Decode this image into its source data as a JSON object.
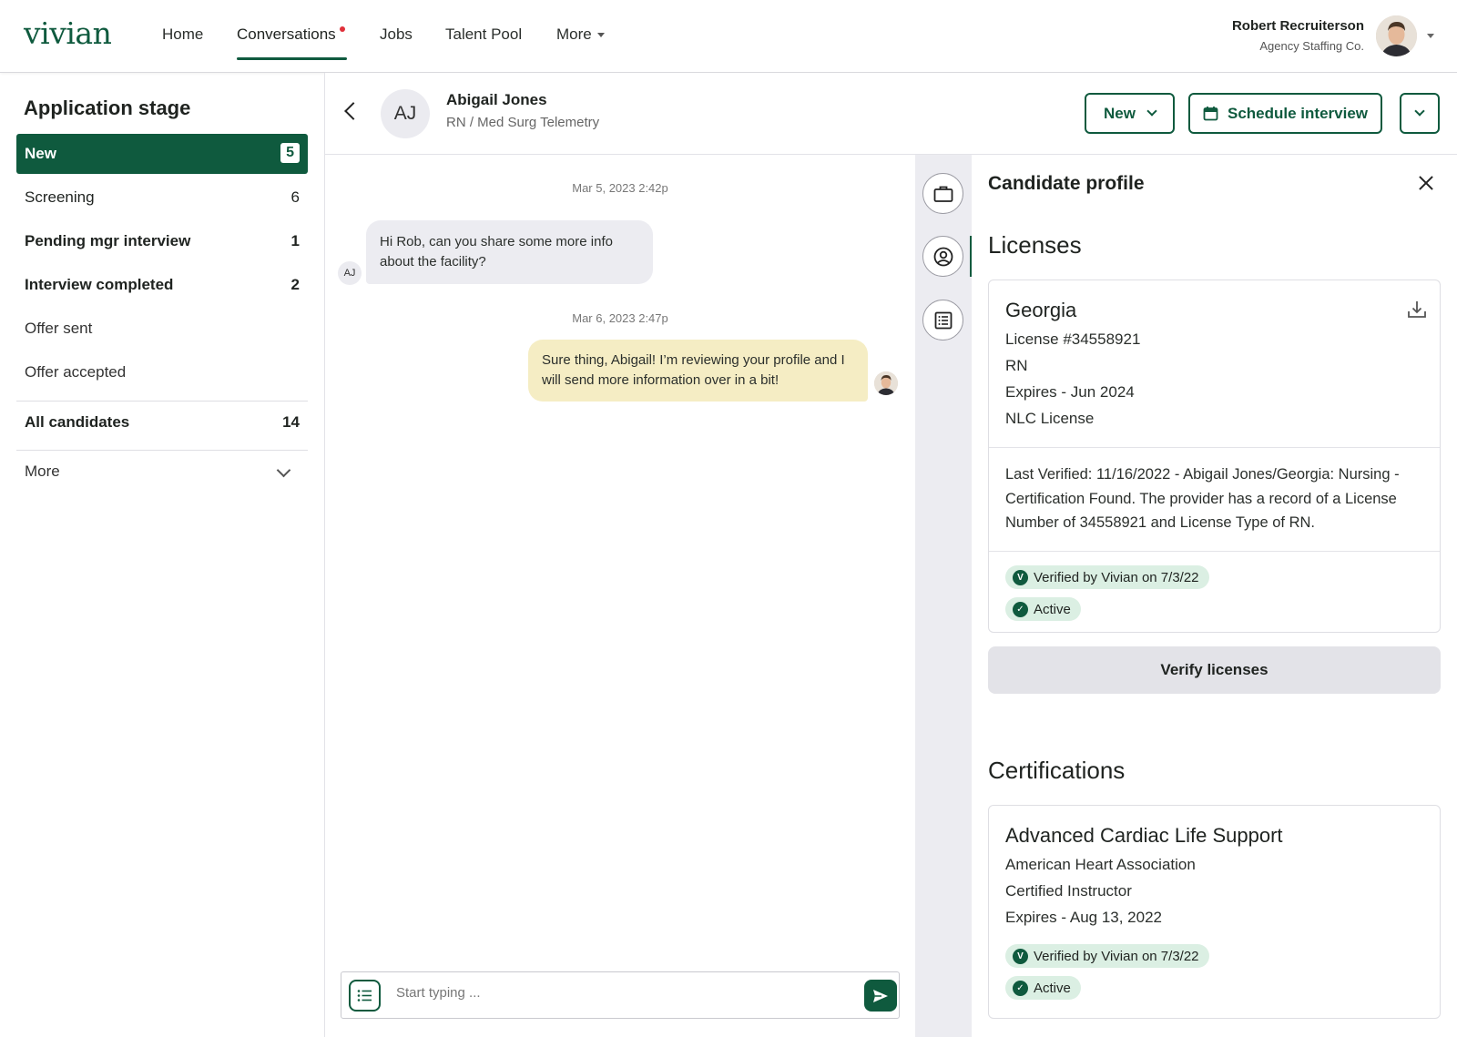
{
  "app": {
    "logo": "vivian",
    "nav": [
      {
        "label": "Home"
      },
      {
        "label": "Conversations",
        "active": true,
        "has_notification": true
      },
      {
        "label": "Jobs"
      },
      {
        "label": "Talent Pool"
      },
      {
        "label": "More"
      }
    ],
    "user": {
      "name": "Robert Recruiterson",
      "company": "Agency Staffing Co."
    },
    "colors": {
      "brand": "#0f5a3e",
      "notification": "#e0303a",
      "badge_bg": "#dbefe3",
      "incoming_bubble": "#ececf1",
      "outgoing_bubble": "#f5edc4"
    }
  },
  "sidebar": {
    "title": "Application stage",
    "stages": [
      {
        "label": "New",
        "count": "5",
        "active": true
      },
      {
        "label": "Screening",
        "count": "6"
      },
      {
        "label": "Pending mgr interview",
        "count": "1"
      },
      {
        "label": "Interview completed",
        "count": "2"
      },
      {
        "label": "Offer sent",
        "count": ""
      },
      {
        "label": "Offer accepted",
        "count": ""
      }
    ],
    "all_candidates": {
      "label": "All candidates",
      "count": "14"
    },
    "more": "More"
  },
  "conversation": {
    "candidate": {
      "initials": "AJ",
      "name": "Abigail Jones",
      "role": "RN / Med Surg Telemetry"
    },
    "stage_button": "New",
    "schedule_button": "Schedule interview",
    "messages": [
      {
        "timestamp": "Mar 5, 2023 2:42p",
        "direction": "incoming",
        "sender_initials": "AJ",
        "text": "Hi Rob, can you share some more info about the facility?"
      },
      {
        "timestamp": "Mar 6, 2023 2:47p",
        "direction": "outgoing",
        "text": "Sure thing, Abigail! I’m reviewing your profile and I will send more information over in a bit!"
      }
    ],
    "composer": {
      "placeholder": "Start typing ..."
    }
  },
  "rail": {
    "icons": [
      "briefcase-icon",
      "user-circle-icon",
      "list-icon"
    ],
    "active_index": 1
  },
  "profile": {
    "title": "Candidate profile",
    "licenses": {
      "title": "Licenses",
      "cards": [
        {
          "state": "Georgia",
          "number": "License #34558921",
          "type": "RN",
          "expires": "Expires - Jun 2024",
          "kind": "NLC License",
          "verification_note": "Last Verified: 11/16/2022 - Abigail Jones/Georgia: Nursing - Certification  Found. The provider has a record of a License Number of 34558921 and License Type of RN.",
          "badges": [
            "Verified by Vivian on 7/3/22",
            "Active"
          ]
        }
      ],
      "verify_button": "Verify licenses"
    },
    "certifications": {
      "title": "Certifications",
      "cards": [
        {
          "name": "Advanced Cardiac Life Support",
          "issuer": "American Heart Association",
          "role": "Certified Instructor",
          "expires": "Expires - Aug 13, 2022",
          "badges": [
            "Verified by Vivian on 7/3/22",
            "Active"
          ]
        }
      ]
    }
  }
}
